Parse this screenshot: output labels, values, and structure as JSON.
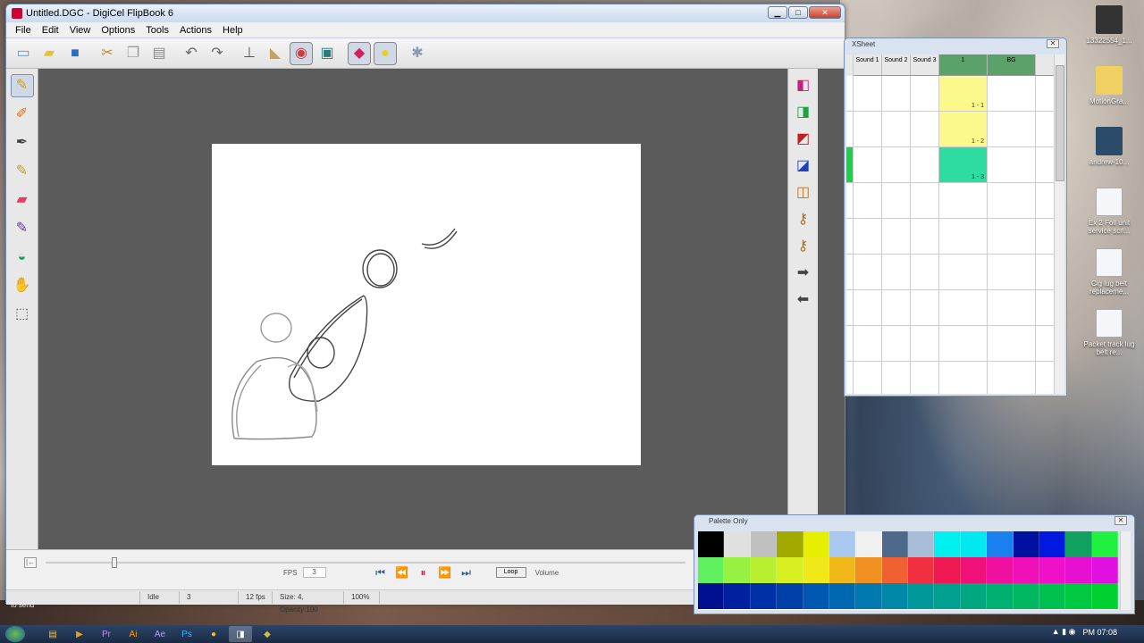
{
  "app": {
    "title": "Untitled.DGC - DigiCel FlipBook 6"
  },
  "menu": [
    "File",
    "Edit",
    "View",
    "Options",
    "Tools",
    "Actions",
    "Help"
  ],
  "window_buttons": {
    "minimize": "▁",
    "maximize": "□",
    "close": "✕"
  },
  "toolbar_icons": [
    "new-scene-icon",
    "open-icon",
    "save-icon",
    "cut-icon",
    "copy-icon",
    "paste-icon",
    "undo-icon",
    "redo-icon",
    "stamp-icon",
    "eraser-tool-icon",
    "palette-icon",
    "film-icon",
    "paint-icon",
    "lasso-icon",
    "settings-icon"
  ],
  "left_tools": [
    "pencil-icon",
    "brush-icon",
    "pen-icon",
    "paint-brush-icon",
    "eraser-icon",
    "ink-icon",
    "fill-icon",
    "hand-icon",
    "select-rect-icon"
  ],
  "right_tools": [
    "layer-up-icon",
    "layer-down-icon",
    "flip-icon",
    "move-icon",
    "copy-cel-icon",
    "key-icon",
    "key2-icon",
    "arrow-right-icon",
    "arrow-left-icon"
  ],
  "playback": {
    "fps_label": "FPS",
    "fps_value": "3",
    "loop_label": "Loop",
    "volume_label": "Volume"
  },
  "status": {
    "state": "Idle",
    "frame": "3",
    "fps": "12 fps",
    "brush": "Size: 4, Opacity:100",
    "zoom": "100%"
  },
  "xsheet": {
    "title": "XSheet",
    "columns": [
      "Sound 1",
      "Sound 2",
      "Sound 3",
      "1",
      "BG"
    ],
    "cells": [
      {
        "row": 1,
        "label": "1 - 1"
      },
      {
        "row": 2,
        "label": "1 - 2"
      },
      {
        "row": 3,
        "label": "1 - 3"
      }
    ]
  },
  "palette": {
    "title": "Palette Only",
    "colors": [
      "#000000",
      "#e0e0e0",
      "#c0c0c0",
      "#a2aa00",
      "#e6ef00",
      "#a8c8f0",
      "#f0f0f0",
      "#4e6a8a",
      "#a8bcd8",
      "#00f0f0",
      "#00e8f0",
      "#1a80f0",
      "#0010a0",
      "#0018e0",
      "#10a060",
      "#20f040",
      "#60f060",
      "#98f040",
      "#b8f030",
      "#d8f020",
      "#f0e818",
      "#f0b818",
      "#f09020",
      "#f06030",
      "#f03040",
      "#f01850",
      "#f01078",
      "#f010a0",
      "#f010b8",
      "#f010c8",
      "#e810d0",
      "#e010e0",
      "#001090",
      "#0020a0",
      "#0030a8",
      "#0040a8",
      "#0058b0",
      "#0068b0",
      "#0078b0",
      "#0088a8",
      "#009898",
      "#00a090",
      "#00a880",
      "#00b070",
      "#00b860",
      "#00c050",
      "#00c840",
      "#00d030"
    ]
  },
  "desktop": {
    "icons": [
      {
        "label": "13322554_1..."
      },
      {
        "label": "MotionGra..."
      },
      {
        "label": "andrew-10..."
      },
      {
        "label": "Ex 2 Foil unit service scri..."
      },
      {
        "label": "Cig lug belt replaceme..."
      },
      {
        "label": "Packet track lug belt re..."
      }
    ],
    "to_send": "to send"
  },
  "taskbar": {
    "apps": [
      "explorer-icon",
      "media-icon",
      "premiere-icon",
      "illustrator-icon",
      "aftereffects-icon",
      "photoshop-icon",
      "chrome-icon",
      "flipbook-icon",
      "other-icon"
    ],
    "clock": "PM 07:08"
  }
}
